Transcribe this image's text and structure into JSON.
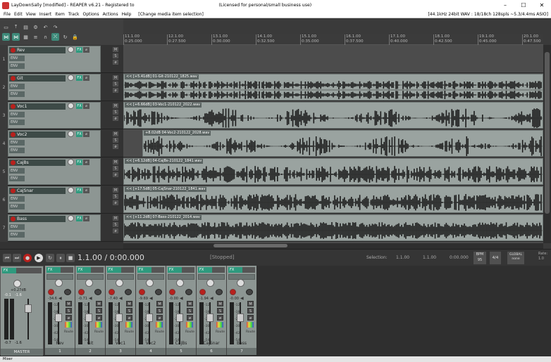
{
  "window": {
    "title": "LayDownSally [modified] - REAPER v6.21 - Registered to",
    "license": "(Licensed for personal/small business use)"
  },
  "menu": {
    "items": [
      "File",
      "Edit",
      "View",
      "Insert",
      "Item",
      "Track",
      "Options",
      "Actions",
      "Help"
    ],
    "change_media": "[Change media item selection]",
    "status": "[44.1kHz 24bit WAV : 18/18ch 128spls ~5.3/4.4ms ASIO]"
  },
  "ruler": {
    "marks": [
      {
        "bar": "11.1.00",
        "time": "0:25.000"
      },
      {
        "bar": "12.1.00",
        "time": "0:27.500"
      },
      {
        "bar": "13.1.00",
        "time": "0:30.000"
      },
      {
        "bar": "14.1.00",
        "time": "0:32.500"
      },
      {
        "bar": "15.1.00",
        "time": "0:35.000"
      },
      {
        "bar": "16.1.00",
        "time": "0:37.500"
      },
      {
        "bar": "17.1.00",
        "time": "0:40.000"
      },
      {
        "bar": "18.1.00",
        "time": "0:42.500"
      },
      {
        "bar": "19.1.00",
        "time": "0:45.000"
      },
      {
        "bar": "20.1.00",
        "time": "0:47.500"
      }
    ]
  },
  "tracks": [
    {
      "num": "1",
      "name": "Rev",
      "item": ""
    },
    {
      "num": "2",
      "name": "Git",
      "item": "<< [+5.41dB] 01-Git-210122_1825.wav"
    },
    {
      "num": "3",
      "name": "Voc1",
      "item": "<< [+6.66dB] 03-Voc1-210122_2022.wav"
    },
    {
      "num": "4",
      "name": "Voc2",
      "item": "+8.02dB 04-Voc2-210122_2028.wav"
    },
    {
      "num": "5",
      "name": "CajBs",
      "item": "<< [+6.12dB] 04-CajBs-210122_1841.wav"
    },
    {
      "num": "6",
      "name": "CajSnar",
      "item": "<< [+17.5dB] 05-CajSnar-210122_1841.wav"
    },
    {
      "num": "7",
      "name": "Bass",
      "item": "<< [+11.2dB] 07-Bass-210122_2014.wav"
    }
  ],
  "track_labels": {
    "fx": "FX",
    "env": "ENV",
    "m": "M",
    "s": "S"
  },
  "transport": {
    "time": "1.1.00 / 0:00.000",
    "state": "[Stopped]",
    "selection_label": "Selection:",
    "sel_start": "1.1.00",
    "sel_end": "1.1.00",
    "sel_len": "0:00.000",
    "bpm_label": "BPM",
    "bpm": "95",
    "timesig": "4/4",
    "global_label": "GLOBAL",
    "global_value": "none",
    "rate_label": "Rate:",
    "rate": "1.0"
  },
  "mixer": {
    "master": {
      "name": "MASTER",
      "db": "+0.27dB",
      "peak_l": "-0.1",
      "peak_r": "-1.6",
      "vol_l": "-0.7",
      "vol_r": "-1.6"
    },
    "strips": [
      {
        "name": "Rev",
        "num": "1",
        "db": "-34.6",
        "route": "Route"
      },
      {
        "name": "Git",
        "num": "2",
        "db": "-0.71",
        "route": "Route"
      },
      {
        "name": "Voc1",
        "num": "3",
        "db": "-7.40",
        "route": "Route"
      },
      {
        "name": "Voc2",
        "num": "4",
        "db": "-9.69",
        "route": "Route"
      },
      {
        "name": "CajBs",
        "num": "5",
        "db": "-0.00",
        "route": "Route"
      },
      {
        "name": "CajSnar",
        "num": "6",
        "db": "-1.94",
        "route": "Route"
      },
      {
        "name": "Bass",
        "num": "7",
        "db": "-0.00",
        "route": "Route"
      }
    ],
    "scale": [
      "-12",
      "-18",
      "-24",
      "-30",
      "-42",
      "-54"
    ],
    "tab": "Mixer"
  }
}
